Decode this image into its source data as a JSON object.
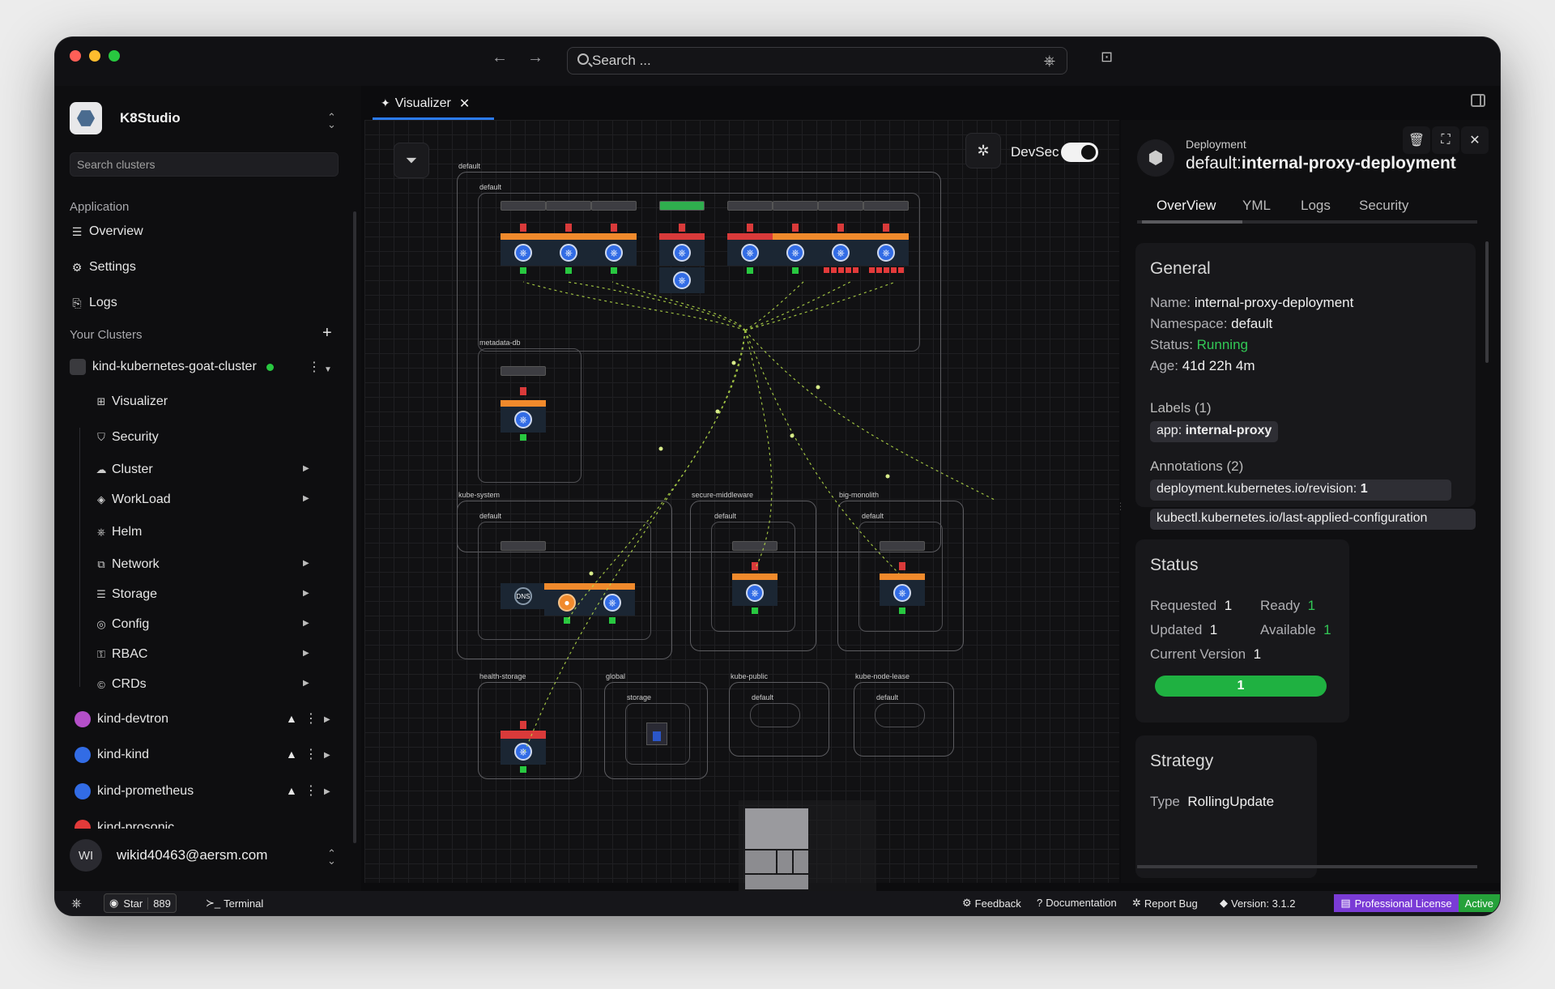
{
  "app": {
    "name": "K8Studio"
  },
  "search": {
    "placeholder": "Search ..."
  },
  "sidebar": {
    "cluster_search_placeholder": "Search clusters",
    "application_label": "Application",
    "app_items": [
      {
        "label": "Overview",
        "icon": "server-icon"
      },
      {
        "label": "Settings",
        "icon": "gear-icon"
      },
      {
        "label": "Logs",
        "icon": "logs-icon"
      }
    ],
    "clusters_label": "Your Clusters",
    "active_cluster": {
      "name": "kind-kubernetes-goat-cluster",
      "status_color": "#28c840"
    },
    "cluster_items": [
      {
        "label": "Visualizer"
      },
      {
        "label": "Security"
      },
      {
        "label": "Cluster"
      },
      {
        "label": "WorkLoad"
      },
      {
        "label": "Helm"
      },
      {
        "label": "Network"
      },
      {
        "label": "Storage"
      },
      {
        "label": "Config"
      },
      {
        "label": "RBAC"
      },
      {
        "label": "CRDs"
      }
    ],
    "other_clusters": [
      {
        "name": "kind-devtron",
        "color": "#b44fc8"
      },
      {
        "name": "kind-kind",
        "color": "#326ce5"
      },
      {
        "name": "kind-prometheus",
        "color": "#326ce5"
      },
      {
        "name": "kind-prosonic",
        "color": "#e23a3a"
      }
    ],
    "user": {
      "initials": "WI",
      "email": "wikid40463@aersm.com"
    }
  },
  "tabs": [
    {
      "label": "Visualizer"
    }
  ],
  "canvas": {
    "devsec_label": "DevSec",
    "namespaces": {
      "default": "default",
      "default_inner": "default",
      "metadata_db": "metadata-db",
      "kube_system": "kube-system",
      "kube_system_inner": "default",
      "secure_middleware": "secure-middleware",
      "secure_middleware_inner": "default",
      "big_monolith": "big-monolith",
      "big_monolith_inner": "default",
      "health_storage": "health-storage",
      "global": "global",
      "global_inner": "storage",
      "kube_public": "kube-public",
      "kube_public_inner": "default",
      "kube_node_lease": "kube-node-lease",
      "kube_node_lease_inner": "default"
    },
    "dns_label": "DNS"
  },
  "detail": {
    "kind": "Deployment",
    "namespace_prefix": "default:",
    "name_bold": "internal-proxy-deployment",
    "tabs": [
      "OverView",
      "YML",
      "Logs",
      "Security"
    ],
    "general": {
      "title": "General",
      "name_key": "Name:",
      "name": "internal-proxy-deployment",
      "ns_key": "Namespace:",
      "namespace": "default",
      "status_key": "Status:",
      "status": "Running",
      "age_key": "Age:",
      "age": "41d 22h 4m",
      "labels_title": "Labels (1)",
      "label_key": "app:",
      "label_val": "internal-proxy",
      "annotations_title": "Annotations (2)",
      "annotation1_key": "deployment.kubernetes.io/revision:",
      "annotation1_val": "1",
      "annotation2_key": "kubectl.kubernetes.io/last-applied-configuration"
    },
    "status": {
      "title": "Status",
      "requested_key": "Requested",
      "requested": "1",
      "ready_key": "Ready",
      "ready": "1",
      "updated_key": "Updated",
      "updated": "1",
      "available_key": "Available",
      "available": "1",
      "version_key": "Current Version",
      "version": "1",
      "progress": "1",
      "progress_fraction": 1.0
    },
    "strategy": {
      "title": "Strategy",
      "type_key": "Type",
      "type": "RollingUpdate"
    }
  },
  "statusbar": {
    "star_label": "Star",
    "star_count": "889",
    "terminal": "Terminal",
    "feedback": "Feedback",
    "documentation": "Documentation",
    "report_bug": "Report Bug",
    "version": "Version: 3.1.2",
    "license": "Professional License",
    "license_status": "Active"
  },
  "colors": {
    "accent": "#2b7bf2",
    "running": "#32c856",
    "license": "#7a3bd6",
    "active": "#25a23a"
  }
}
